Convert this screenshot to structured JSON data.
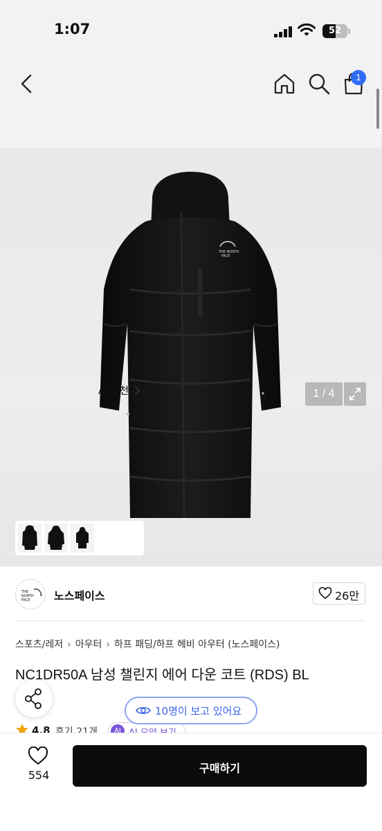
{
  "status_bar": {
    "time": "1:07",
    "battery": "52",
    "battery_level": 0.52
  },
  "header": {
    "cart_badge": "1"
  },
  "gallery": {
    "ai_recommend_label": "AI 추천",
    "counter": "1 / 4"
  },
  "brand": {
    "name": "노스페이스",
    "logo_text": "THE NORTH FACE",
    "like_count": "26만"
  },
  "breadcrumb": [
    "스포츠/레저",
    "아우터",
    "하프 패딩/하프 헤비 아우터 (노스페이스)"
  ],
  "product": {
    "title": "NC1DR50A 남성 챌린지 에어 다운 코트 (RDS) BL",
    "rating": "4.8",
    "review_label": "후기 21개",
    "ai_badge": "AI",
    "ai_summary_label": "AI 요약 보기"
  },
  "viewers": {
    "label": "10명이 보고 있어요"
  },
  "bottom_bar": {
    "wish_count": "554",
    "buy_label": "구매하기"
  },
  "colors": {
    "accent_blue": "#3b66e6",
    "badge_blue": "#2f6df6",
    "ai_purple": "#7a52d8",
    "buy_button": "#0b0b0b"
  }
}
